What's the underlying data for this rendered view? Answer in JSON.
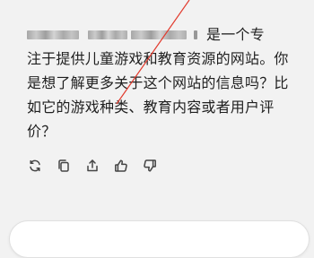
{
  "message": {
    "line1_suffix": "是一个专",
    "line2": "注于提供儿童游戏和教育资源的网站。你",
    "line3": "是想了解更多关于这个网站的信息吗？比",
    "line4": "如它的游戏种类、教育内容或者用户评",
    "line5": "价？"
  },
  "actions": [
    {
      "icon": "regenerate-icon"
    },
    {
      "icon": "copy-icon"
    },
    {
      "icon": "share-icon"
    },
    {
      "icon": "thumbs-up-icon"
    },
    {
      "icon": "thumbs-down-icon"
    }
  ],
  "colors": {
    "background": "#f2f2f2",
    "text": "#1f1f1f",
    "annotation": "#e23b2e"
  }
}
